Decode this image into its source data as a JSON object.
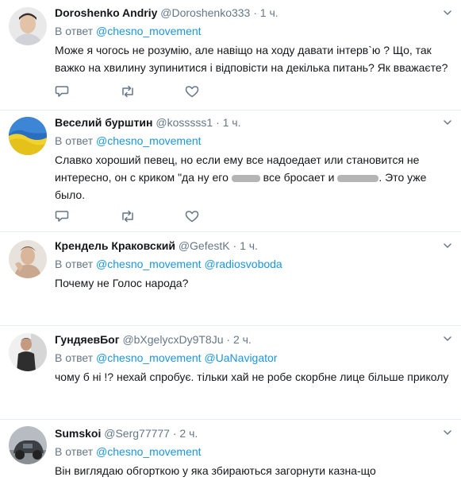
{
  "reply_prefix": "В ответ",
  "tweets": [
    {
      "name": "Doroshenko Andriy",
      "handle": "@Doroshenko333",
      "dot": "·",
      "time": "1 ч.",
      "mentions": [
        "@chesno_movement"
      ],
      "text": "Може я чогось не розумію, але навіщо на ходу давати інтерв`ю ? Що, так важко на хвилину зупинитися і відповісти на декілька питань? Як вважаєте?"
    },
    {
      "name": "Веселий бурштин",
      "handle": "@kosssss1",
      "dot": "·",
      "time": "1 ч.",
      "mentions": [
        "@chesno_movement"
      ],
      "text_a": "Славко хороший певец, но если ему все надоедает или становится не интересно, он с криком \"да ну его ",
      "text_b": " все бросает и ",
      "text_c": ". Это уже было."
    },
    {
      "name": "Крендель Краковский",
      "handle": "@GefestK",
      "dot": "·",
      "time": "1 ч.",
      "mentions": [
        "@chesno_movement",
        "@radiosvoboda"
      ],
      "text": "Почему не Голос народа?"
    },
    {
      "name": "ГундяевБог",
      "handle": "@bXgelycxDy9T8Ju",
      "dot": "·",
      "time": "2 ч.",
      "mentions": [
        "@chesno_movement",
        "@UaNavigator"
      ],
      "text": "чому б ні !? нехай спробує. тільки хай не робе скорбне лице більше приколу"
    },
    {
      "name": "Sumskoi",
      "handle": "@Serg77777",
      "dot": "·",
      "time": "2 ч.",
      "mentions": [
        "@chesno_movement"
      ],
      "text": "Він виглядаю обгорткою у яка збираються загорнути казна-що"
    }
  ],
  "icons": {
    "reply": "reply-icon",
    "retweet": "retweet-icon",
    "like": "like-icon",
    "caret": "chevron-down-icon"
  },
  "colors": {
    "name": "#14171a",
    "secondary": "#657786",
    "link": "#1b95e0",
    "divider": "#e6ecf0"
  }
}
